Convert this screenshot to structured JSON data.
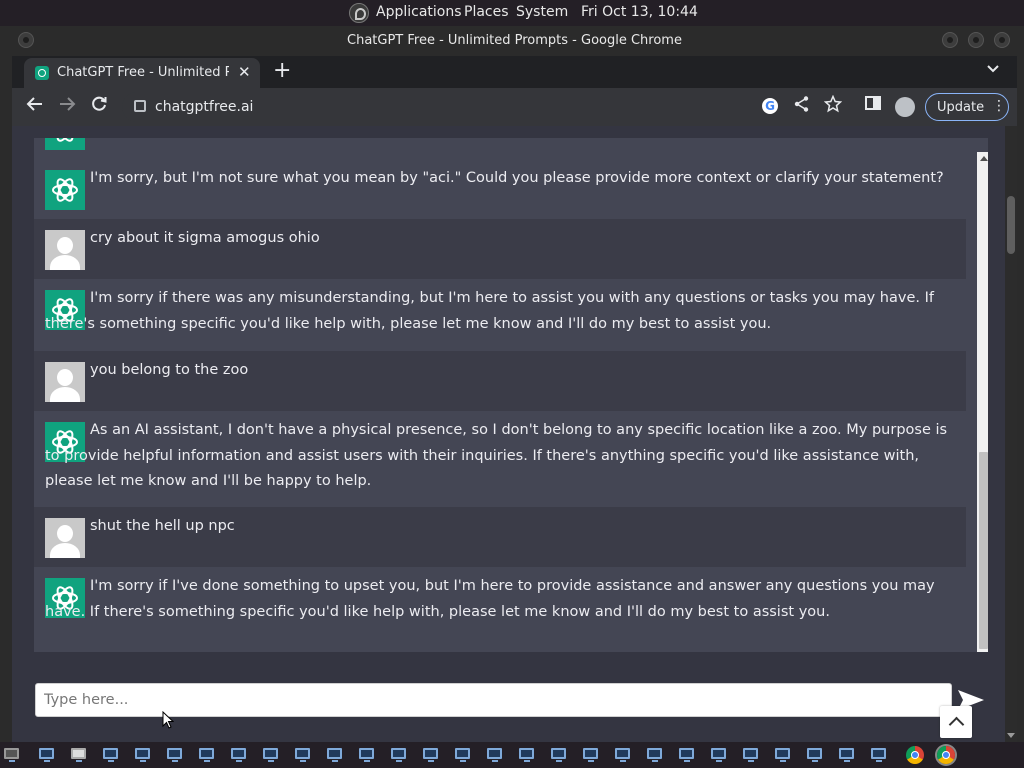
{
  "desktop": {
    "menu": [
      "Applications",
      "Places",
      "System"
    ],
    "clock": "Fri Oct 13, 10:44"
  },
  "window": {
    "title": "ChatGPT Free - Unlimited Prompts - Google Chrome"
  },
  "browser": {
    "tab_title": "ChatGPT Free - Unlimited Prompts",
    "tab_close": "✕",
    "new_tab": "+",
    "url": "chatgptfree.ai",
    "update_label": "Update"
  },
  "chat": {
    "messages": [
      {
        "role": "assistant",
        "text": "I'm sorry, but I'm not sure what you mean by \"aci.\" Could you please provide more context or clarify your statement?"
      },
      {
        "role": "user",
        "text": "cry about it sigma amogus ohio"
      },
      {
        "role": "assistant",
        "text": "I'm sorry if there was any misunderstanding, but I'm here to assist you with any questions or tasks you may have. If there's something specific you'd like help with, please let me know and I'll do my best to assist you."
      },
      {
        "role": "user",
        "text": "you belong to the zoo"
      },
      {
        "role": "assistant",
        "text": "As an AI assistant, I don't have a physical presence, so I don't belong to any specific location like a zoo. My purpose is to provide helpful information and assist users with their inquiries. If there's anything specific you'd like assistance with, please let me know and I'll be happy to help."
      },
      {
        "role": "user",
        "text": "shut the hell up npc"
      },
      {
        "role": "assistant",
        "text": "I'm sorry if I've done something to upset you, but I'm here to provide assistance and answer any questions you may have. If there's something specific you'd like help with, please let me know and I'll do my best to assist you."
      }
    ],
    "input_placeholder": "Type here...",
    "input_value": ""
  },
  "icons": {
    "back": "back-arrow-icon",
    "forward": "forward-arrow-icon",
    "reload": "reload-icon",
    "share": "share-icon",
    "bookmark": "star-icon",
    "side_panel": "side-panel-icon",
    "send": "send-icon"
  },
  "colors": {
    "chatgpt_green": "#10a37f",
    "page_bg": "#343541",
    "assistant_bg": "#444654",
    "user_bg": "#3b3c48",
    "update_border": "#8ab4f8"
  }
}
